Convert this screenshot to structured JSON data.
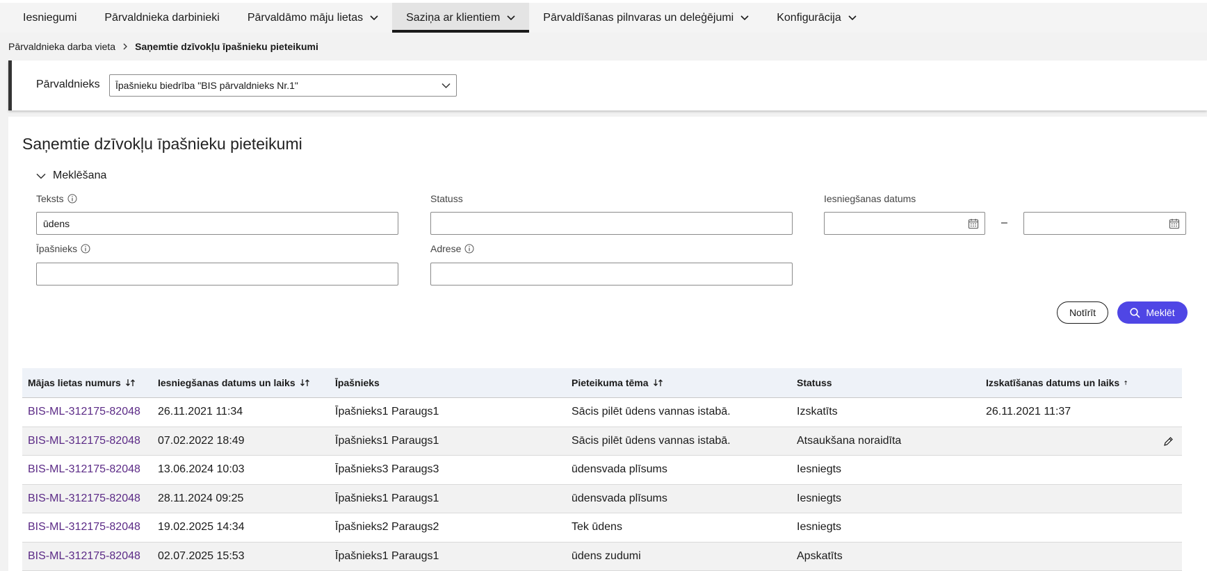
{
  "nav": {
    "items": [
      {
        "label": "Iesniegumi"
      },
      {
        "label": "Pārvaldnieka darbinieki"
      },
      {
        "label": "Pārvaldāmo māju lietas"
      },
      {
        "label": "Saziņa ar klientiem"
      },
      {
        "label": "Pārvaldīšanas pilnvaras un deleģējumi"
      },
      {
        "label": "Konfigurācija"
      }
    ]
  },
  "breadcrumb": {
    "parent": "Pārvaldnieka darba vieta",
    "current": "Saņemtie dzīvokļu īpašnieku pieteikumi"
  },
  "manager": {
    "label": "Pārvaldnieks",
    "selected": "Īpašnieku biedrība \"BIS pārvaldnieks Nr.1\""
  },
  "page": {
    "title": "Saņemtie dzīvokļu īpašnieku pieteikumi"
  },
  "search": {
    "toggle_label": "Meklēšana",
    "text_label": "Teksts",
    "text_value": "ūdens",
    "status_label": "Statuss",
    "status_value": "",
    "date_label": "Iesniegšanas datums",
    "date_from": "",
    "date_to": "",
    "date_separator": "–",
    "owner_label": "Īpašnieks",
    "owner_value": "",
    "address_label": "Adrese",
    "address_value": "",
    "clear_label": "Notīrīt",
    "search_label": "Meklēt"
  },
  "table": {
    "headers": [
      "Mājas lietas numurs",
      "Iesniegšanas datums un laiks",
      "Īpašnieks",
      "Pieteikuma tēma",
      "Statuss",
      "Izskatīšanas datums un laiks"
    ],
    "rows": [
      {
        "case": "BIS-ML-312175-82048",
        "submitted": "26.11.2021 11:34",
        "owner": "Īpašnieks1 Paraugs1",
        "topic": "Sācis pilēt ūdens vannas istabā.",
        "status": "Izskatīts",
        "reviewed": "26.11.2021 11:37"
      },
      {
        "case": "BIS-ML-312175-82048",
        "submitted": "07.02.2022 18:49",
        "owner": "Īpašnieks1 Paraugs1",
        "topic": "Sācis pilēt ūdens vannas istabā.",
        "status": "Atsaukšana noraidīta",
        "reviewed": ""
      },
      {
        "case": "BIS-ML-312175-82048",
        "submitted": "13.06.2024 10:03",
        "owner": "Īpašnieks3 Paraugs3",
        "topic": "ūdensvada plīsums",
        "status": "Iesniegts",
        "reviewed": ""
      },
      {
        "case": "BIS-ML-312175-82048",
        "submitted": "28.11.2024 09:25",
        "owner": "Īpašnieks1 Paraugs1",
        "topic": "ūdensvada plīsums",
        "status": "Iesniegts",
        "reviewed": ""
      },
      {
        "case": "BIS-ML-312175-82048",
        "submitted": "19.02.2025 14:34",
        "owner": "Īpašnieks2 Paraugs2",
        "topic": "Tek ūdens",
        "status": "Iesniegts",
        "reviewed": ""
      },
      {
        "case": "BIS-ML-312175-82048",
        "submitted": "02.07.2025 15:53",
        "owner": "Īpašnieks1 Paraugs1",
        "topic": "ūdens zudumi",
        "status": "Apskatīts",
        "reviewed": ""
      }
    ]
  },
  "colors": {
    "accent": "#4f46e5",
    "link": "#5b2a86",
    "header_bg": "#eef2f8"
  }
}
